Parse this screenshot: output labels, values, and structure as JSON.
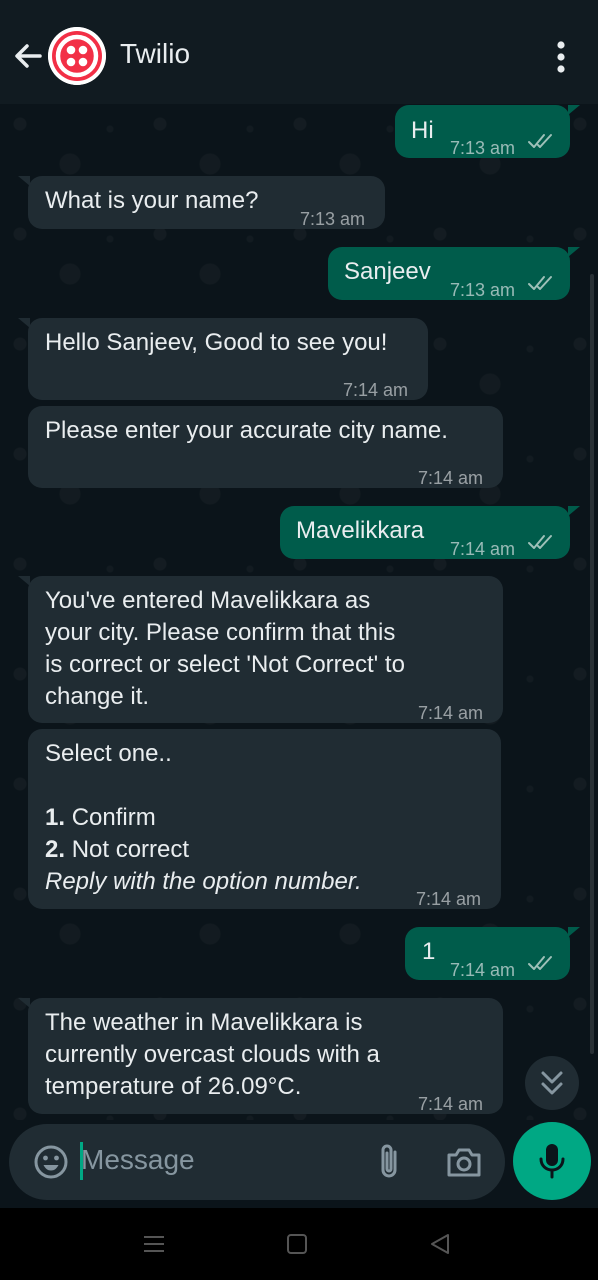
{
  "header": {
    "title": "Twilio"
  },
  "messages": [
    {
      "dir": "out",
      "text": [
        "Hi"
      ],
      "time": "7:13 am",
      "read": true
    },
    {
      "dir": "in",
      "text": [
        "What is your name?"
      ],
      "time": "7:13 am"
    },
    {
      "dir": "out",
      "text": [
        "Sanjeev"
      ],
      "time": "7:13 am",
      "read": true
    },
    {
      "dir": "in",
      "text": [
        "Hello Sanjeev, Good to see you!"
      ],
      "time": "7:14 am"
    },
    {
      "dir": "in",
      "text": [
        "Please enter your accurate city name."
      ],
      "time": "7:14 am"
    },
    {
      "dir": "out",
      "text": [
        "Mavelikkara"
      ],
      "time": "7:14 am",
      "read": true
    },
    {
      "dir": "in",
      "text": [
        "You've entered Mavelikkara as",
        "your city. Please confirm that this",
        "is correct or select 'Not Correct' to",
        "change it."
      ],
      "time": "7:14 am"
    },
    {
      "dir": "in",
      "title": "Select one..",
      "options": [
        {
          "num": "1.",
          "label": "Confirm"
        },
        {
          "num": "2.",
          "label": "Not correct"
        }
      ],
      "hint": "Reply with the option number.",
      "time": "7:14 am"
    },
    {
      "dir": "out",
      "text": [
        "1"
      ],
      "time": "7:14 am",
      "read": true
    },
    {
      "dir": "in",
      "text": [
        "The weather in Mavelikkara is",
        "currently overcast clouds with a",
        "temperature of 26.09°C."
      ],
      "time": "7:14 am"
    }
  ],
  "input": {
    "placeholder": "Message"
  },
  "icons": {
    "back": "arrow-left",
    "avatar": "twilio-logo",
    "menu": "more-vertical",
    "emoji": "smiley",
    "attach": "paperclip",
    "camera": "camera",
    "mic": "microphone",
    "scroll": "double-chevron-down",
    "ticks": "double-check"
  },
  "colors": {
    "accent": "#00a884",
    "outgoing": "#005c4b",
    "incoming": "#202c33",
    "background": "#0b141a",
    "brand": "#f22f46"
  }
}
